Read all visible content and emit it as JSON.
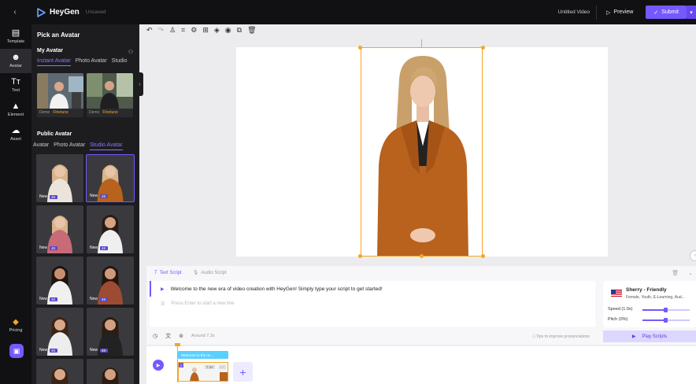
{
  "topbar": {
    "back": "‹",
    "brand": "HeyGen",
    "unsaved": "Unsaved",
    "video_title": "Untitled Video",
    "preview": "Preview",
    "submit": "Submit"
  },
  "rail": {
    "items": [
      {
        "label": "Template",
        "icon": "template-icon"
      },
      {
        "label": "Avatar",
        "icon": "avatar-icon"
      },
      {
        "label": "Text",
        "icon": "text-icon"
      },
      {
        "label": "Element",
        "icon": "element-icon"
      },
      {
        "label": "Asset",
        "icon": "asset-icon"
      }
    ],
    "pricing": "Pricing"
  },
  "panel": {
    "title": "Pick an Avatar",
    "my_avatar": {
      "title": "My Avatar",
      "tabs": [
        "Instant Avatar",
        "Photo Avatar",
        "Studio"
      ],
      "cards": [
        {
          "tag1": "Demo",
          "tag2": "Finetune"
        },
        {
          "tag1": "Demo",
          "tag2": "Finetune"
        }
      ]
    },
    "public_avatar": {
      "title": "Public Avatar",
      "tabs": [
        "Avatar",
        "Photo Avatar",
        "Studio Avatar"
      ],
      "new_label": "New",
      "res_label": "4K"
    }
  },
  "script": {
    "tab_text": "Text Script",
    "tab_audio": "Audio Script",
    "line1": "Welcome to the new era of video creation with HeyGen! Simply type your script to get started!",
    "placeholder": "Press Enter to start a new line",
    "around": "Around 7.2s",
    "tips": "Tips to improve pronunciations",
    "voice": {
      "name": "Sherry - Friendly",
      "desc": "Female, Youth, E-Learning, Aud...",
      "speed": "Speed (1.0x)",
      "pitch": "Pitch (0%)"
    },
    "play_scripts": "Play Scripts"
  },
  "timeline": {
    "chip": "Welcome to the ne...",
    "scene_number": "1",
    "duration": "7.2s",
    "more": "···",
    "add": "+"
  },
  "colors": {
    "accent": "#7559ff",
    "selection": "#f5a623",
    "dark": "#111113"
  }
}
